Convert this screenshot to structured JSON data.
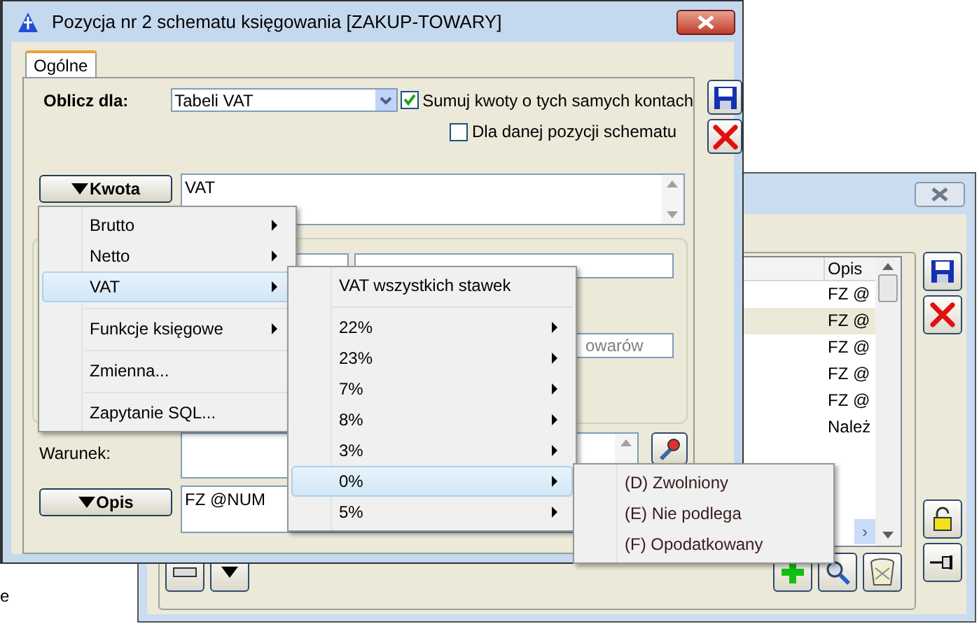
{
  "background_text": "e",
  "back_window": {
    "list": {
      "columns": [
        "Opis"
      ],
      "rows": [
        {
          "opis": "FZ @",
          "selected": false
        },
        {
          "opis": "FZ @",
          "selected": true
        },
        {
          "opis": "FZ @",
          "selected": false
        },
        {
          "opis": "FZ @",
          "selected": false
        },
        {
          "opis": "FZ @",
          "selected": false
        },
        {
          "opis": "Należ",
          "selected": false
        }
      ],
      "scroll_right": "›"
    }
  },
  "window": {
    "title": "Pozycja nr 2 schematu księgowania [ZAKUP-TOWARY]",
    "tabs": [
      {
        "label": "Ogólne",
        "selected": true
      }
    ],
    "oblicz_dla_label": "Oblicz dla:",
    "oblicz_dla_value": "Tabeli VAT",
    "checkboxes": [
      {
        "label": "Sumuj kwoty o tych samych kontach",
        "checked": true
      },
      {
        "label": "Dla danej pozycji schematu",
        "checked": false
      }
    ],
    "kwota_button": "Kwota",
    "kwota_value": "VAT",
    "partial_field": "owarów",
    "warunek_label": "Warunek:",
    "opis_button": "Opis",
    "opis_value": "FZ @NUM"
  },
  "menus": [
    {
      "items": [
        {
          "kind": "item",
          "label": "Brutto",
          "submenu": true,
          "selected": false
        },
        {
          "kind": "item",
          "label": "Netto",
          "submenu": true,
          "selected": false
        },
        {
          "kind": "item",
          "label": "VAT",
          "submenu": true,
          "selected": true
        },
        {
          "kind": "separator"
        },
        {
          "kind": "item",
          "label": "Funkcje księgowe",
          "submenu": true,
          "selected": false
        },
        {
          "kind": "separator"
        },
        {
          "kind": "item",
          "label": "Zmienna...",
          "submenu": false,
          "selected": false
        },
        {
          "kind": "separator"
        },
        {
          "kind": "item",
          "label": "Zapytanie SQL...",
          "submenu": false,
          "selected": false
        }
      ]
    },
    {
      "items": [
        {
          "kind": "item",
          "label": "VAT wszystkich stawek",
          "submenu": false,
          "selected": false
        },
        {
          "kind": "separator"
        },
        {
          "kind": "item",
          "label": "22%",
          "submenu": true,
          "selected": false
        },
        {
          "kind": "item",
          "label": "23%",
          "submenu": true,
          "selected": false
        },
        {
          "kind": "item",
          "label": "7%",
          "submenu": true,
          "selected": false
        },
        {
          "kind": "item",
          "label": "8%",
          "submenu": true,
          "selected": false
        },
        {
          "kind": "item",
          "label": "3%",
          "submenu": true,
          "selected": false
        },
        {
          "kind": "item",
          "label": "0%",
          "submenu": true,
          "selected": true
        },
        {
          "kind": "item",
          "label": "5%",
          "submenu": true,
          "selected": false
        }
      ]
    },
    {
      "items": [
        {
          "kind": "item",
          "label": "(D) Zwolniony",
          "submenu": false,
          "selected": false
        },
        {
          "kind": "item",
          "label": "(E) Nie podlega",
          "submenu": false,
          "selected": false
        },
        {
          "kind": "item",
          "label": "(F) Opodatkowany",
          "submenu": false,
          "selected": false
        }
      ]
    }
  ]
}
